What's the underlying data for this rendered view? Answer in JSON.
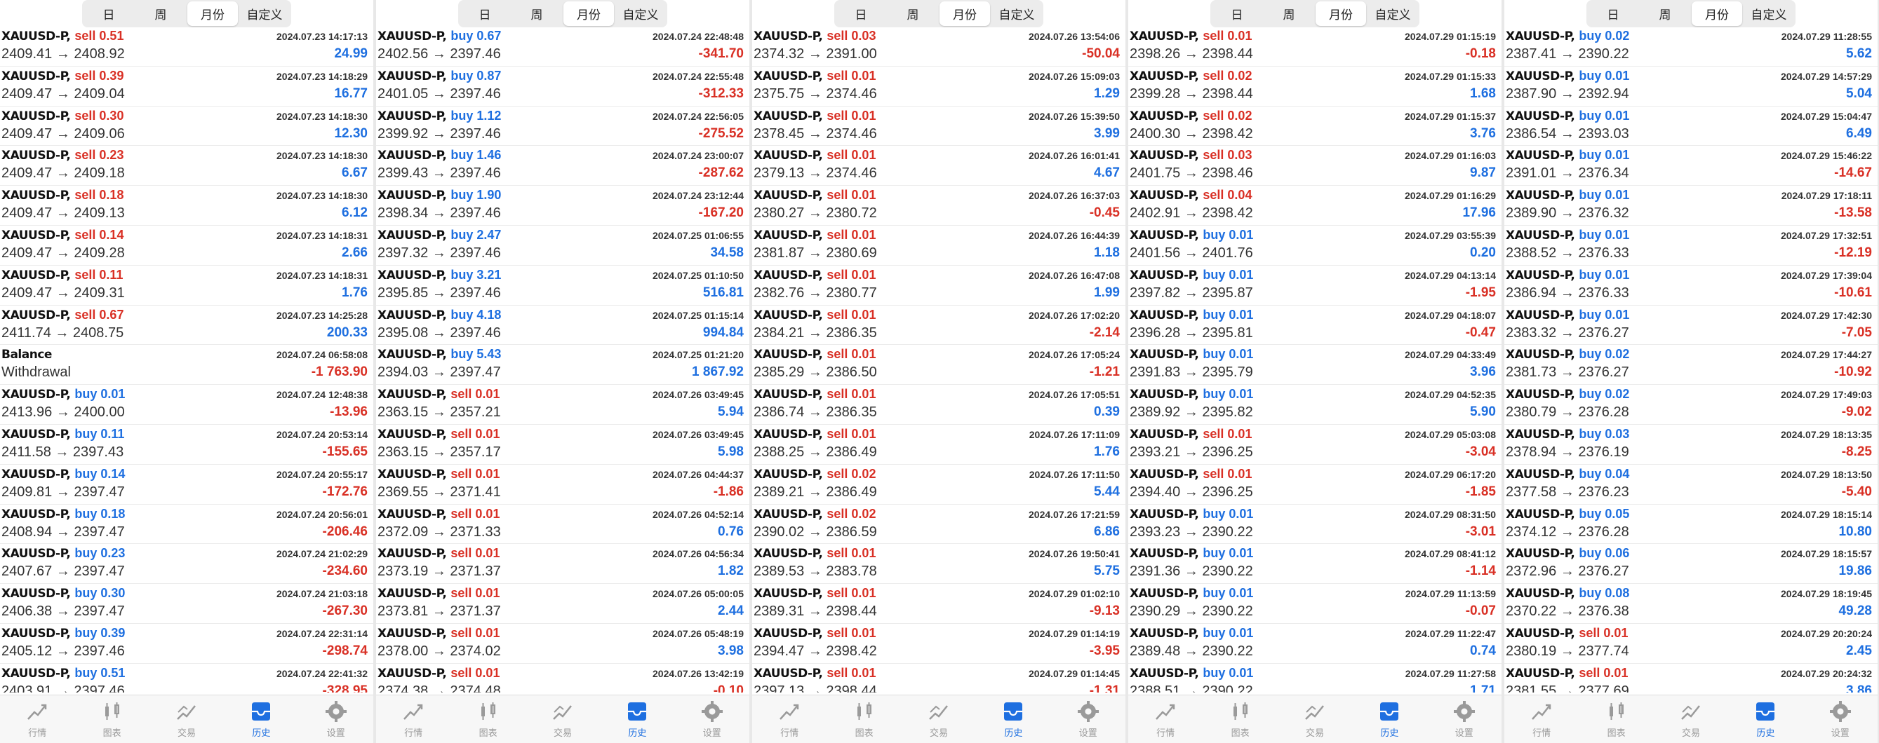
{
  "tabs_segment": [
    "日",
    "周",
    "月份",
    "自定义"
  ],
  "active_segment": 2,
  "nav": [
    "行情",
    "图表",
    "交易",
    "历史",
    "设置"
  ],
  "active_nav": 3,
  "panels": [
    {
      "rows": [
        {
          "sym": "XAUUSD-P,",
          "side": "sell",
          "lot": "0.51",
          "prices": "2409.41 → 2408.92",
          "time": "2024.07.23 14:17:13",
          "profit": "24.99"
        },
        {
          "sym": "XAUUSD-P,",
          "side": "sell",
          "lot": "0.39",
          "prices": "2409.47 → 2409.04",
          "time": "2024.07.23 14:18:29",
          "profit": "16.77"
        },
        {
          "sym": "XAUUSD-P,",
          "side": "sell",
          "lot": "0.30",
          "prices": "2409.47 → 2409.06",
          "time": "2024.07.23 14:18:30",
          "profit": "12.30"
        },
        {
          "sym": "XAUUSD-P,",
          "side": "sell",
          "lot": "0.23",
          "prices": "2409.47 → 2409.18",
          "time": "2024.07.23 14:18:30",
          "profit": "6.67"
        },
        {
          "sym": "XAUUSD-P,",
          "side": "sell",
          "lot": "0.18",
          "prices": "2409.47 → 2409.13",
          "time": "2024.07.23 14:18:30",
          "profit": "6.12"
        },
        {
          "sym": "XAUUSD-P,",
          "side": "sell",
          "lot": "0.14",
          "prices": "2409.47 → 2409.28",
          "time": "2024.07.23 14:18:31",
          "profit": "2.66"
        },
        {
          "sym": "XAUUSD-P,",
          "side": "sell",
          "lot": "0.11",
          "prices": "2409.47 → 2409.31",
          "time": "2024.07.23 14:18:31",
          "profit": "1.76"
        },
        {
          "sym": "XAUUSD-P,",
          "side": "sell",
          "lot": "0.67",
          "prices": "2411.74 → 2408.75",
          "time": "2024.07.23 14:25:28",
          "profit": "200.33"
        },
        {
          "sym": "Balance",
          "side": "",
          "lot": "",
          "prices": "Withdrawal",
          "time": "2024.07.24 06:58:08",
          "profit": "-1 763.90"
        },
        {
          "sym": "XAUUSD-P,",
          "side": "buy",
          "lot": "0.01",
          "prices": "2413.96 → 2400.00",
          "time": "2024.07.24 12:48:38",
          "profit": "-13.96"
        },
        {
          "sym": "XAUUSD-P,",
          "side": "buy",
          "lot": "0.11",
          "prices": "2411.58 → 2397.43",
          "time": "2024.07.24 20:53:14",
          "profit": "-155.65"
        },
        {
          "sym": "XAUUSD-P,",
          "side": "buy",
          "lot": "0.14",
          "prices": "2409.81 → 2397.47",
          "time": "2024.07.24 20:55:17",
          "profit": "-172.76"
        },
        {
          "sym": "XAUUSD-P,",
          "side": "buy",
          "lot": "0.18",
          "prices": "2408.94 → 2397.47",
          "time": "2024.07.24 20:56:01",
          "profit": "-206.46"
        },
        {
          "sym": "XAUUSD-P,",
          "side": "buy",
          "lot": "0.23",
          "prices": "2407.67 → 2397.47",
          "time": "2024.07.24 21:02:29",
          "profit": "-234.60"
        },
        {
          "sym": "XAUUSD-P,",
          "side": "buy",
          "lot": "0.30",
          "prices": "2406.38 → 2397.47",
          "time": "2024.07.24 21:03:18",
          "profit": "-267.30"
        },
        {
          "sym": "XAUUSD-P,",
          "side": "buy",
          "lot": "0.39",
          "prices": "2405.12 → 2397.46",
          "time": "2024.07.24 22:31:14",
          "profit": "-298.74"
        },
        {
          "sym": "XAUUSD-P,",
          "side": "buy",
          "lot": "0.51",
          "prices": "2403.91 → 2397.46",
          "time": "2024.07.24 22:41:32",
          "profit": "-328.95"
        }
      ]
    },
    {
      "rows": [
        {
          "sym": "XAUUSD-P,",
          "side": "buy",
          "lot": "0.67",
          "prices": "2402.56 → 2397.46",
          "time": "2024.07.24 22:48:48",
          "profit": "-341.70"
        },
        {
          "sym": "XAUUSD-P,",
          "side": "buy",
          "lot": "0.87",
          "prices": "2401.05 → 2397.46",
          "time": "2024.07.24 22:55:48",
          "profit": "-312.33"
        },
        {
          "sym": "XAUUSD-P,",
          "side": "buy",
          "lot": "1.12",
          "prices": "2399.92 → 2397.46",
          "time": "2024.07.24 22:56:05",
          "profit": "-275.52"
        },
        {
          "sym": "XAUUSD-P,",
          "side": "buy",
          "lot": "1.46",
          "prices": "2399.43 → 2397.46",
          "time": "2024.07.24 23:00:07",
          "profit": "-287.62"
        },
        {
          "sym": "XAUUSD-P,",
          "side": "buy",
          "lot": "1.90",
          "prices": "2398.34 → 2397.46",
          "time": "2024.07.24 23:12:44",
          "profit": "-167.20"
        },
        {
          "sym": "XAUUSD-P,",
          "side": "buy",
          "lot": "2.47",
          "prices": "2397.32 → 2397.46",
          "time": "2024.07.25 01:06:55",
          "profit": "34.58"
        },
        {
          "sym": "XAUUSD-P,",
          "side": "buy",
          "lot": "3.21",
          "prices": "2395.85 → 2397.46",
          "time": "2024.07.25 01:10:50",
          "profit": "516.81"
        },
        {
          "sym": "XAUUSD-P,",
          "side": "buy",
          "lot": "4.18",
          "prices": "2395.08 → 2397.46",
          "time": "2024.07.25 01:15:14",
          "profit": "994.84"
        },
        {
          "sym": "XAUUSD-P,",
          "side": "buy",
          "lot": "5.43",
          "prices": "2394.03 → 2397.47",
          "time": "2024.07.25 01:21:20",
          "profit": "1 867.92"
        },
        {
          "sym": "XAUUSD-P,",
          "side": "sell",
          "lot": "0.01",
          "prices": "2363.15 → 2357.21",
          "time": "2024.07.26 03:49:45",
          "profit": "5.94"
        },
        {
          "sym": "XAUUSD-P,",
          "side": "sell",
          "lot": "0.01",
          "prices": "2363.15 → 2357.17",
          "time": "2024.07.26 03:49:45",
          "profit": "5.98"
        },
        {
          "sym": "XAUUSD-P,",
          "side": "sell",
          "lot": "0.01",
          "prices": "2369.55 → 2371.41",
          "time": "2024.07.26 04:44:37",
          "profit": "-1.86"
        },
        {
          "sym": "XAUUSD-P,",
          "side": "sell",
          "lot": "0.01",
          "prices": "2372.09 → 2371.33",
          "time": "2024.07.26 04:52:14",
          "profit": "0.76"
        },
        {
          "sym": "XAUUSD-P,",
          "side": "sell",
          "lot": "0.01",
          "prices": "2373.19 → 2371.37",
          "time": "2024.07.26 04:56:34",
          "profit": "1.82"
        },
        {
          "sym": "XAUUSD-P,",
          "side": "sell",
          "lot": "0.01",
          "prices": "2373.81 → 2371.37",
          "time": "2024.07.26 05:00:05",
          "profit": "2.44"
        },
        {
          "sym": "XAUUSD-P,",
          "side": "sell",
          "lot": "0.01",
          "prices": "2378.00 → 2374.02",
          "time": "2024.07.26 05:48:19",
          "profit": "3.98"
        },
        {
          "sym": "XAUUSD-P,",
          "side": "sell",
          "lot": "0.01",
          "prices": "2374.38 → 2374.48",
          "time": "2024.07.26 13:42:19",
          "profit": "-0.10"
        }
      ]
    },
    {
      "rows": [
        {
          "sym": "XAUUSD-P,",
          "side": "sell",
          "lot": "0.03",
          "prices": "2374.32 → 2391.00",
          "time": "2024.07.26 13:54:06",
          "profit": "-50.04"
        },
        {
          "sym": "XAUUSD-P,",
          "side": "sell",
          "lot": "0.01",
          "prices": "2375.75 → 2374.46",
          "time": "2024.07.26 15:09:03",
          "profit": "1.29"
        },
        {
          "sym": "XAUUSD-P,",
          "side": "sell",
          "lot": "0.01",
          "prices": "2378.45 → 2374.46",
          "time": "2024.07.26 15:39:50",
          "profit": "3.99"
        },
        {
          "sym": "XAUUSD-P,",
          "side": "sell",
          "lot": "0.01",
          "prices": "2379.13 → 2374.46",
          "time": "2024.07.26 16:01:41",
          "profit": "4.67"
        },
        {
          "sym": "XAUUSD-P,",
          "side": "sell",
          "lot": "0.01",
          "prices": "2380.27 → 2380.72",
          "time": "2024.07.26 16:37:03",
          "profit": "-0.45"
        },
        {
          "sym": "XAUUSD-P,",
          "side": "sell",
          "lot": "0.01",
          "prices": "2381.87 → 2380.69",
          "time": "2024.07.26 16:44:39",
          "profit": "1.18"
        },
        {
          "sym": "XAUUSD-P,",
          "side": "sell",
          "lot": "0.01",
          "prices": "2382.76 → 2380.77",
          "time": "2024.07.26 16:47:08",
          "profit": "1.99"
        },
        {
          "sym": "XAUUSD-P,",
          "side": "sell",
          "lot": "0.01",
          "prices": "2384.21 → 2386.35",
          "time": "2024.07.26 17:02:20",
          "profit": "-2.14"
        },
        {
          "sym": "XAUUSD-P,",
          "side": "sell",
          "lot": "0.01",
          "prices": "2385.29 → 2386.50",
          "time": "2024.07.26 17:05:24",
          "profit": "-1.21"
        },
        {
          "sym": "XAUUSD-P,",
          "side": "sell",
          "lot": "0.01",
          "prices": "2386.74 → 2386.35",
          "time": "2024.07.26 17:05:51",
          "profit": "0.39"
        },
        {
          "sym": "XAUUSD-P,",
          "side": "sell",
          "lot": "0.01",
          "prices": "2388.25 → 2386.49",
          "time": "2024.07.26 17:11:09",
          "profit": "1.76"
        },
        {
          "sym": "XAUUSD-P,",
          "side": "sell",
          "lot": "0.02",
          "prices": "2389.21 → 2386.49",
          "time": "2024.07.26 17:11:50",
          "profit": "5.44"
        },
        {
          "sym": "XAUUSD-P,",
          "side": "sell",
          "lot": "0.02",
          "prices": "2390.02 → 2386.59",
          "time": "2024.07.26 17:21:59",
          "profit": "6.86"
        },
        {
          "sym": "XAUUSD-P,",
          "side": "sell",
          "lot": "0.01",
          "prices": "2389.53 → 2383.78",
          "time": "2024.07.26 19:50:41",
          "profit": "5.75"
        },
        {
          "sym": "XAUUSD-P,",
          "side": "sell",
          "lot": "0.01",
          "prices": "2389.31 → 2398.44",
          "time": "2024.07.29 01:02:10",
          "profit": "-9.13"
        },
        {
          "sym": "XAUUSD-P,",
          "side": "sell",
          "lot": "0.01",
          "prices": "2394.47 → 2398.42",
          "time": "2024.07.29 01:14:19",
          "profit": "-3.95"
        },
        {
          "sym": "XAUUSD-P,",
          "side": "sell",
          "lot": "0.01",
          "prices": "2397.13 → 2398.44",
          "time": "2024.07.29 01:14:45",
          "profit": "-1.31"
        }
      ]
    },
    {
      "rows": [
        {
          "sym": "XAUUSD-P,",
          "side": "sell",
          "lot": "0.01",
          "prices": "2398.26 → 2398.44",
          "time": "2024.07.29 01:15:19",
          "profit": "-0.18"
        },
        {
          "sym": "XAUUSD-P,",
          "side": "sell",
          "lot": "0.02",
          "prices": "2399.28 → 2398.44",
          "time": "2024.07.29 01:15:33",
          "profit": "1.68"
        },
        {
          "sym": "XAUUSD-P,",
          "side": "sell",
          "lot": "0.02",
          "prices": "2400.30 → 2398.42",
          "time": "2024.07.29 01:15:37",
          "profit": "3.76"
        },
        {
          "sym": "XAUUSD-P,",
          "side": "sell",
          "lot": "0.03",
          "prices": "2401.75 → 2398.46",
          "time": "2024.07.29 01:16:03",
          "profit": "9.87"
        },
        {
          "sym": "XAUUSD-P,",
          "side": "sell",
          "lot": "0.04",
          "prices": "2402.91 → 2398.42",
          "time": "2024.07.29 01:16:29",
          "profit": "17.96"
        },
        {
          "sym": "XAUUSD-P,",
          "side": "buy",
          "lot": "0.01",
          "prices": "2401.56 → 2401.76",
          "time": "2024.07.29 03:55:39",
          "profit": "0.20"
        },
        {
          "sym": "XAUUSD-P,",
          "side": "buy",
          "lot": "0.01",
          "prices": "2397.82 → 2395.87",
          "time": "2024.07.29 04:13:14",
          "profit": "-1.95"
        },
        {
          "sym": "XAUUSD-P,",
          "side": "buy",
          "lot": "0.01",
          "prices": "2396.28 → 2395.81",
          "time": "2024.07.29 04:18:07",
          "profit": "-0.47"
        },
        {
          "sym": "XAUUSD-P,",
          "side": "buy",
          "lot": "0.01",
          "prices": "2391.83 → 2395.79",
          "time": "2024.07.29 04:33:49",
          "profit": "3.96"
        },
        {
          "sym": "XAUUSD-P,",
          "side": "buy",
          "lot": "0.01",
          "prices": "2389.92 → 2395.82",
          "time": "2024.07.29 04:52:35",
          "profit": "5.90"
        },
        {
          "sym": "XAUUSD-P,",
          "side": "sell",
          "lot": "0.01",
          "prices": "2393.21 → 2396.25",
          "time": "2024.07.29 05:03:08",
          "profit": "-3.04"
        },
        {
          "sym": "XAUUSD-P,",
          "side": "sell",
          "lot": "0.01",
          "prices": "2394.40 → 2396.25",
          "time": "2024.07.29 06:17:20",
          "profit": "-1.85"
        },
        {
          "sym": "XAUUSD-P,",
          "side": "buy",
          "lot": "0.01",
          "prices": "2393.23 → 2390.22",
          "time": "2024.07.29 08:31:50",
          "profit": "-3.01"
        },
        {
          "sym": "XAUUSD-P,",
          "side": "buy",
          "lot": "0.01",
          "prices": "2391.36 → 2390.22",
          "time": "2024.07.29 08:41:12",
          "profit": "-1.14"
        },
        {
          "sym": "XAUUSD-P,",
          "side": "buy",
          "lot": "0.01",
          "prices": "2390.29 → 2390.22",
          "time": "2024.07.29 11:13:59",
          "profit": "-0.07"
        },
        {
          "sym": "XAUUSD-P,",
          "side": "buy",
          "lot": "0.01",
          "prices": "2389.48 → 2390.22",
          "time": "2024.07.29 11:22:47",
          "profit": "0.74"
        },
        {
          "sym": "XAUUSD-P,",
          "side": "buy",
          "lot": "0.01",
          "prices": "2388.51 → 2390.22",
          "time": "2024.07.29 11:27:58",
          "profit": "1.71"
        }
      ]
    },
    {
      "rows": [
        {
          "sym": "XAUUSD-P,",
          "side": "buy",
          "lot": "0.02",
          "prices": "2387.41 → 2390.22",
          "time": "2024.07.29 11:28:55",
          "profit": "5.62"
        },
        {
          "sym": "XAUUSD-P,",
          "side": "buy",
          "lot": "0.01",
          "prices": "2387.90 → 2392.94",
          "time": "2024.07.29 14:57:29",
          "profit": "5.04"
        },
        {
          "sym": "XAUUSD-P,",
          "side": "buy",
          "lot": "0.01",
          "prices": "2386.54 → 2393.03",
          "time": "2024.07.29 15:04:47",
          "profit": "6.49"
        },
        {
          "sym": "XAUUSD-P,",
          "side": "buy",
          "lot": "0.01",
          "prices": "2391.01 → 2376.34",
          "time": "2024.07.29 15:46:22",
          "profit": "-14.67"
        },
        {
          "sym": "XAUUSD-P,",
          "side": "buy",
          "lot": "0.01",
          "prices": "2389.90 → 2376.32",
          "time": "2024.07.29 17:18:11",
          "profit": "-13.58"
        },
        {
          "sym": "XAUUSD-P,",
          "side": "buy",
          "lot": "0.01",
          "prices": "2388.52 → 2376.33",
          "time": "2024.07.29 17:32:51",
          "profit": "-12.19"
        },
        {
          "sym": "XAUUSD-P,",
          "side": "buy",
          "lot": "0.01",
          "prices": "2386.94 → 2376.33",
          "time": "2024.07.29 17:39:04",
          "profit": "-10.61"
        },
        {
          "sym": "XAUUSD-P,",
          "side": "buy",
          "lot": "0.01",
          "prices": "2383.32 → 2376.27",
          "time": "2024.07.29 17:42:30",
          "profit": "-7.05"
        },
        {
          "sym": "XAUUSD-P,",
          "side": "buy",
          "lot": "0.02",
          "prices": "2381.73 → 2376.27",
          "time": "2024.07.29 17:44:27",
          "profit": "-10.92"
        },
        {
          "sym": "XAUUSD-P,",
          "side": "buy",
          "lot": "0.02",
          "prices": "2380.79 → 2376.28",
          "time": "2024.07.29 17:49:03",
          "profit": "-9.02"
        },
        {
          "sym": "XAUUSD-P,",
          "side": "buy",
          "lot": "0.03",
          "prices": "2378.94 → 2376.19",
          "time": "2024.07.29 18:13:35",
          "profit": "-8.25"
        },
        {
          "sym": "XAUUSD-P,",
          "side": "buy",
          "lot": "0.04",
          "prices": "2377.58 → 2376.23",
          "time": "2024.07.29 18:13:50",
          "profit": "-5.40"
        },
        {
          "sym": "XAUUSD-P,",
          "side": "buy",
          "lot": "0.05",
          "prices": "2374.12 → 2376.28",
          "time": "2024.07.29 18:15:14",
          "profit": "10.80"
        },
        {
          "sym": "XAUUSD-P,",
          "side": "buy",
          "lot": "0.06",
          "prices": "2372.96 → 2376.27",
          "time": "2024.07.29 18:15:57",
          "profit": "19.86"
        },
        {
          "sym": "XAUUSD-P,",
          "side": "buy",
          "lot": "0.08",
          "prices": "2370.22 → 2376.38",
          "time": "2024.07.29 18:19:45",
          "profit": "49.28"
        },
        {
          "sym": "XAUUSD-P,",
          "side": "sell",
          "lot": "0.01",
          "prices": "2380.19 → 2377.74",
          "time": "2024.07.29 20:20:24",
          "profit": "2.45"
        },
        {
          "sym": "XAUUSD-P,",
          "side": "sell",
          "lot": "0.01",
          "prices": "2381.55 → 2377.69",
          "time": "2024.07.29 20:24:32",
          "profit": "3.86"
        }
      ]
    }
  ],
  "colors": {
    "buy": "#1e6fe0",
    "sell": "#d93025",
    "active": "#1e6fe0"
  }
}
